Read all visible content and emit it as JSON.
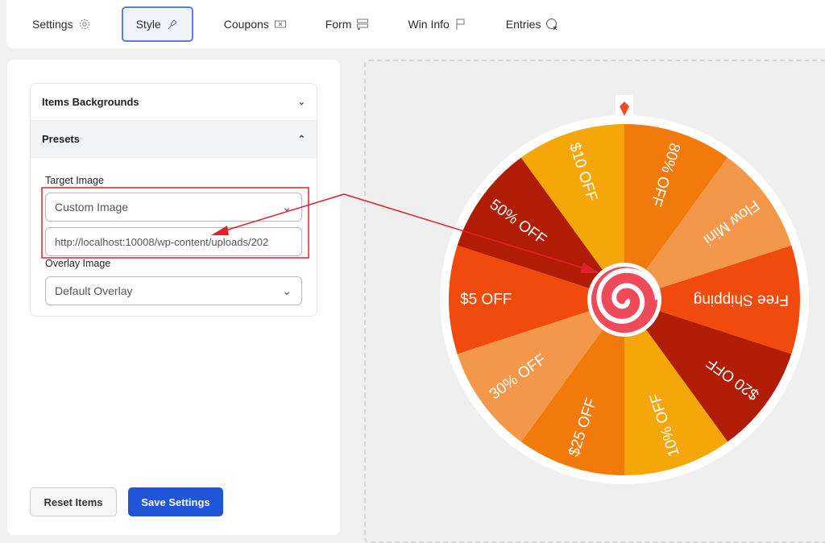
{
  "tabs": [
    {
      "label": "Settings",
      "icon": "gear-icon"
    },
    {
      "label": "Style",
      "icon": "brush-icon",
      "active": true
    },
    {
      "label": "Coupons",
      "icon": "coupon-icon"
    },
    {
      "label": "Form",
      "icon": "form-icon"
    },
    {
      "label": "Win Info",
      "icon": "flag-icon"
    },
    {
      "label": "Entries",
      "icon": "entries-icon"
    }
  ],
  "accordion": {
    "items_backgrounds": "Items Backgrounds",
    "presets": "Presets"
  },
  "presets": {
    "target_label": "Target Image",
    "target_value": "Custom Image",
    "url_value": "http://localhost:10008/wp-content/uploads/202",
    "overlay_label": "Overlay Image",
    "overlay_value": "Default Overlay"
  },
  "buttons": {
    "reset": "Reset Items",
    "save": "Save Settings"
  },
  "wheel": {
    "segments": [
      {
        "label": "Free Shipping",
        "color": "#f04a0c"
      },
      {
        "label": "$20 OFF",
        "color": "#b11d04"
      },
      {
        "label": "10% OFF",
        "color": "#f5a70a"
      },
      {
        "label": "$25 OFF",
        "color": "#f27a0b"
      },
      {
        "label": "30% OFF",
        "color": "#f3984a"
      },
      {
        "label": "$5 OFF",
        "color": "#f04a0c"
      },
      {
        "label": "50% OFF",
        "color": "#b11d04"
      },
      {
        "label": "$10 OFF",
        "color": "#f5a70a"
      },
      {
        "label": "80% OFF",
        "color": "#f27a0b"
      },
      {
        "label": "Flow Mini",
        "color": "#f3984a"
      }
    ],
    "pointer_color": "#ee4b2b",
    "hub_color": "#ee4a5a"
  },
  "annotation_color": "#e0202e"
}
